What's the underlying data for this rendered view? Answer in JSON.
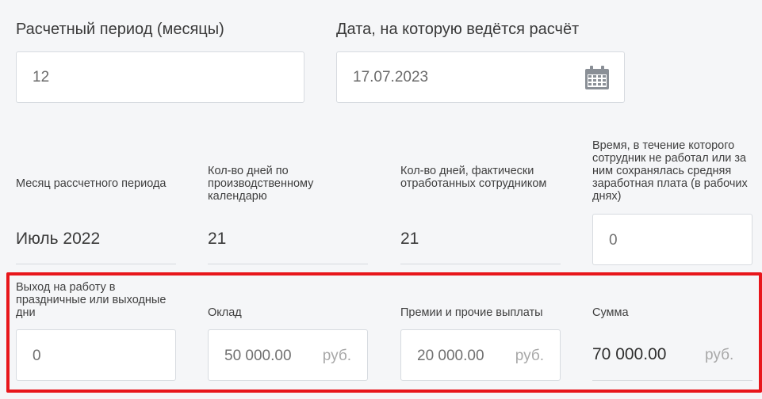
{
  "top": {
    "period_label": "Расчетный период (месяцы)",
    "period_value": "12",
    "date_label": "Дата, на которую ведётся расчёт",
    "date_value": "17.07.2023"
  },
  "columns": {
    "month_label": "Месяц рассчетного периода",
    "calendar_days_label": "Кол-во дней по производственному календарю",
    "worked_days_label": "Кол-во дней, фактически отработанных сотрудником",
    "absent_label": "Время, в течение которого сотрудник не работал или за ним сохранялась средняя заработная плата (в рабочих днях)"
  },
  "row": {
    "month": "Июль 2022",
    "calendar_days": "21",
    "worked_days": "21",
    "absent_days": "0"
  },
  "highlighted": {
    "holiday_label": "Выход на работу в праздничные или выходные дни",
    "holiday_value": "0",
    "salary_label": "Оклад",
    "salary_value": "50 000.00",
    "bonus_label": "Премии и прочие выплаты",
    "bonus_value": "20 000.00",
    "sum_label": "Сумма",
    "sum_value": "70 000.00",
    "currency": "руб."
  },
  "icons": {
    "calendar": "calendar-icon"
  },
  "colors": {
    "highlight_border": "#e8161b",
    "background": "#f5f6f8"
  }
}
